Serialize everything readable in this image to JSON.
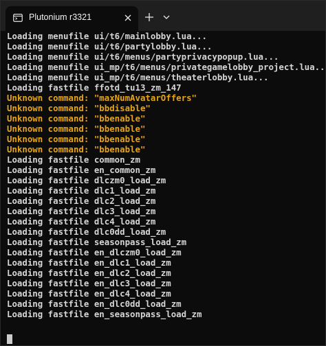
{
  "window": {
    "tab_title": "Plutonium r3321",
    "tab_close": "×",
    "new_tab": "+",
    "dropdown": "⌄"
  },
  "console": {
    "lines": [
      {
        "text": "Loading menufile ui/t6/mainlobby.lua...",
        "level": "info"
      },
      {
        "text": "Loading menufile ui/t6/partylobby.lua...",
        "level": "info"
      },
      {
        "text": "Loading menufile ui/t6/menus/partyprivacypopup.lua...",
        "level": "info"
      },
      {
        "text": "Loading menufile ui_mp/t6/menus/privategamelobby_project.lua...",
        "level": "info"
      },
      {
        "text": "Loading menufile ui_mp/t6/menus/theaterlobby.lua...",
        "level": "info"
      },
      {
        "text": "Loading fastfile ffotd_tu13_zm_147",
        "level": "info"
      },
      {
        "text": "Unknown command: \"maxNumAvatarOffers\"",
        "level": "warn"
      },
      {
        "text": "Unknown command: \"bbdisable\"",
        "level": "warn"
      },
      {
        "text": "Unknown command: \"bbenable\"",
        "level": "warn"
      },
      {
        "text": "Unknown command: \"bbenable\"",
        "level": "warn"
      },
      {
        "text": "Unknown command: \"bbenable\"",
        "level": "warn"
      },
      {
        "text": "Unknown command: \"bbenable\"",
        "level": "warn"
      },
      {
        "text": "Loading fastfile common_zm",
        "level": "info"
      },
      {
        "text": "Loading fastfile en_common_zm",
        "level": "info"
      },
      {
        "text": "Loading fastfile dlczm0_load_zm",
        "level": "info"
      },
      {
        "text": "Loading fastfile dlc1_load_zm",
        "level": "info"
      },
      {
        "text": "Loading fastfile dlc2_load_zm",
        "level": "info"
      },
      {
        "text": "Loading fastfile dlc3_load_zm",
        "level": "info"
      },
      {
        "text": "Loading fastfile dlc4_load_zm",
        "level": "info"
      },
      {
        "text": "Loading fastfile dlc0dd_load_zm",
        "level": "info"
      },
      {
        "text": "Loading fastfile seasonpass_load_zm",
        "level": "info"
      },
      {
        "text": "Loading fastfile en_dlczm0_load_zm",
        "level": "info"
      },
      {
        "text": "Loading fastfile en_dlc1_load_zm",
        "level": "info"
      },
      {
        "text": "Loading fastfile en_dlc2_load_zm",
        "level": "info"
      },
      {
        "text": "Loading fastfile en_dlc3_load_zm",
        "level": "info"
      },
      {
        "text": "Loading fastfile en_dlc4_load_zm",
        "level": "info"
      },
      {
        "text": "Loading fastfile en_dlc0dd_load_zm",
        "level": "info"
      },
      {
        "text": "Loading fastfile en_seasonpass_load_zm",
        "level": "info"
      }
    ]
  },
  "colors": {
    "background": "#0c0c0c",
    "titlebar": "#1f1f1f",
    "text": "#d6d6d6",
    "warning": "#e6a418"
  },
  "icons": {
    "tab": "terminal-icon",
    "close": "close-icon",
    "new_tab": "plus-icon",
    "dropdown": "chevron-down-icon"
  }
}
